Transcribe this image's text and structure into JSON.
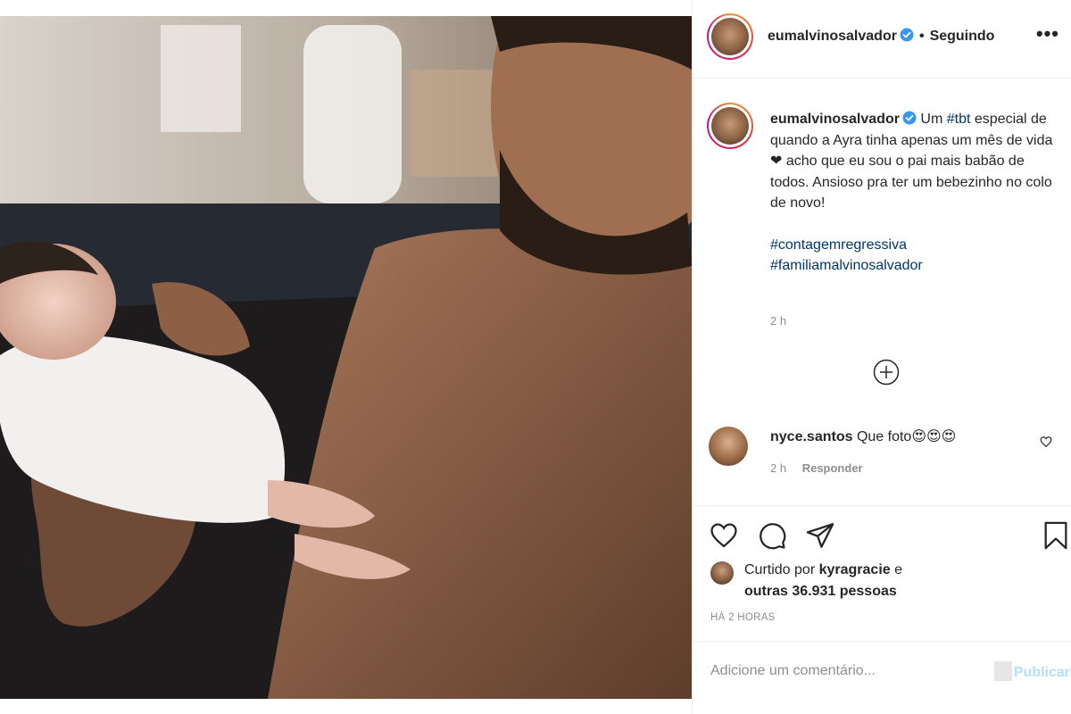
{
  "post": {
    "author": "eumalvinosalvador",
    "follow_status": "Seguindo",
    "more_glyph": "•••"
  },
  "caption": {
    "intro": "Um ",
    "hashtag_inline": "#tbt",
    "body": " especial de quando a Ayra tinha apenas um mês de vida ❤ acho que eu sou o pai mais babão de todos. Ansioso pra ter um bebezinho no colo de novo!",
    "hashtags": [
      "#contagemregressiva",
      "#familiamalvinosalvador"
    ],
    "time": "2 h"
  },
  "comments": [
    {
      "user": "nyce.santos",
      "text": "Que foto😍😍😍",
      "time": "2 h",
      "reply_label": "Responder"
    }
  ],
  "likes": {
    "prefix": "Curtido por ",
    "first_user": "kyragracie",
    "connector": " e",
    "others": "outras 36.931 pessoas"
  },
  "posted_ago": "HÁ 2 HORAS",
  "comment_box": {
    "placeholder": "Adicione um comentário...",
    "publish_label": "Publicar"
  },
  "icons": {
    "like": "heart-icon",
    "comment": "comment-icon",
    "share": "share-icon",
    "save": "bookmark-icon",
    "load_more": "plus-circle-icon"
  },
  "colors": {
    "link": "#00376b",
    "muted": "#8e8e8e",
    "publish_disabled": "#b2dffc",
    "verified": "#3897f0"
  }
}
